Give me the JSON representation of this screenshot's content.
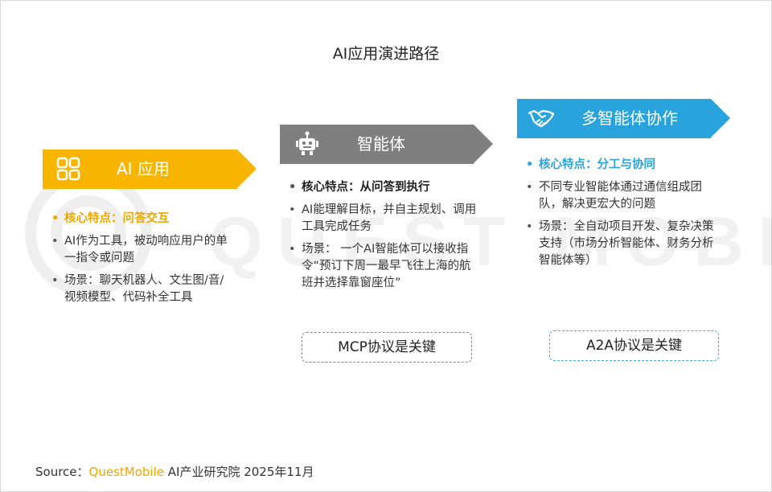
{
  "title": "AI应用演进路径",
  "stages": [
    {
      "label": "AI 应用",
      "icon": "apps-grid-icon",
      "color": "#f7b500",
      "points": [
        {
          "text": "核心特点：问答交互",
          "key": true
        },
        {
          "text": "AI作为工具，被动响应用户的单一指令或问题",
          "key": false
        },
        {
          "text": "场景：聊天机器人、文生图/音/视频模型、代码补全工具",
          "key": false
        }
      ]
    },
    {
      "label": "智能体",
      "icon": "robot-icon",
      "color": "#7f7f7f",
      "points": [
        {
          "text": "核心特点：从问答到执行",
          "key": true
        },
        {
          "text": "AI能理解目标，并自主规划、调用工具完成任务",
          "key": false
        },
        {
          "text": "场景： 一个AI智能体可以接收指令“预订下周一最早飞往上海的航班并选择靠窗座位”",
          "key": false
        }
      ],
      "protocol": "MCP协议是关键"
    },
    {
      "label": "多智能体协作",
      "icon": "handshake-icon",
      "color": "#29a3db",
      "points": [
        {
          "text": "核心特点：分工与协同",
          "key": true
        },
        {
          "text": "不同专业智能体通过通信组成团队，解决更宏大的问题",
          "key": false
        },
        {
          "text": "场景：全自动项目开发、复杂决策支持（市场分析智能体、财务分析智能体等）",
          "key": false
        }
      ],
      "protocol": "A2A协议是关键"
    }
  ],
  "source": {
    "prefix": "Source：",
    "brand": "QuestMobile",
    "suffix": " AI产业研究院 2025年11月"
  },
  "watermark_text": "QUESTMOBILE"
}
